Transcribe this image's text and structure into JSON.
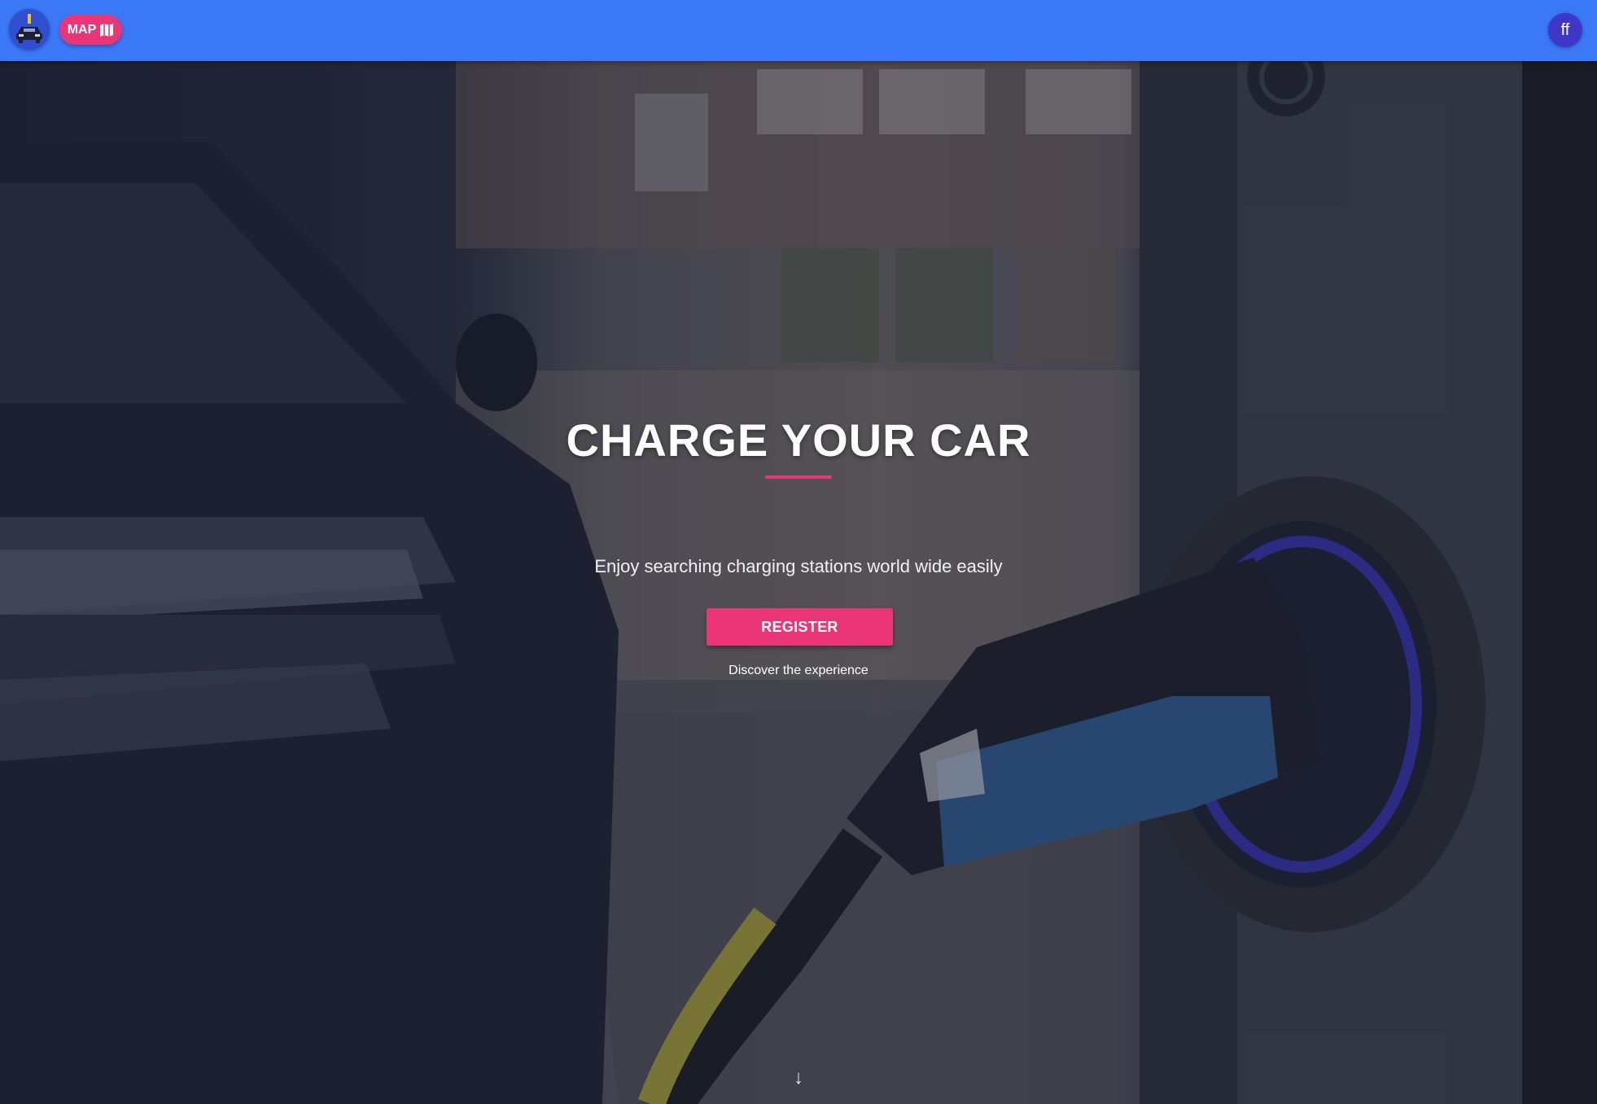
{
  "header": {
    "logo_icon": "car-charging-logo-icon",
    "map_button_label": "MAP",
    "map_icon": "map-icon",
    "avatar_initials": "ff",
    "bar_color": "#3a78f7",
    "accent_color": "#ea3677"
  },
  "hero": {
    "background": "electric-car-charging-photo",
    "title": "CHARGE YOUR CAR",
    "subtitle": "Enjoy searching charging stations world wide easily",
    "register_label": "REGISTER",
    "discover_text": "Discover the experience",
    "scroll_icon": "arrow-down-icon",
    "scroll_glyph": "↓"
  }
}
